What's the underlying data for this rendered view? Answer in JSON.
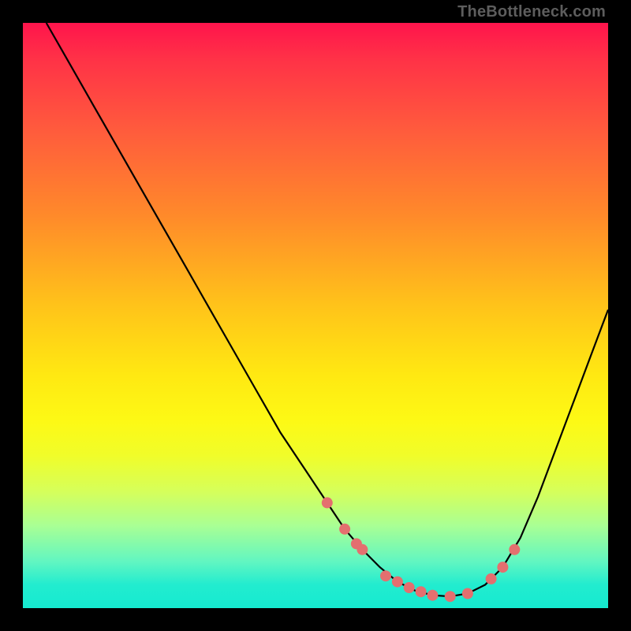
{
  "watermark": "TheBottleneck.com",
  "colors": {
    "frame_border": "#000000",
    "curve_stroke": "#000000",
    "dot_fill": "#e46f6f",
    "gradient_top": "#ff144c",
    "gradient_bottom": "#15ead0"
  },
  "chart_data": {
    "type": "line",
    "title": "",
    "xlabel": "",
    "ylabel": "",
    "xlim": [
      0,
      100
    ],
    "ylim": [
      0,
      100
    ],
    "x": [
      4,
      8,
      12,
      16,
      20,
      24,
      28,
      32,
      36,
      40,
      44,
      48,
      52,
      55,
      58,
      61,
      64,
      67,
      70,
      73,
      76,
      79,
      82,
      85,
      88,
      91,
      94,
      97,
      100
    ],
    "values": [
      100,
      93,
      86,
      79,
      72,
      65,
      58,
      51,
      44,
      37,
      30,
      24,
      18,
      13.5,
      10,
      7,
      4.5,
      3,
      2.2,
      2,
      2.5,
      4,
      7,
      12,
      19,
      27,
      35,
      43,
      51
    ],
    "highlight_points": [
      {
        "x": 52,
        "y": 18
      },
      {
        "x": 55,
        "y": 13.5
      },
      {
        "x": 57,
        "y": 11
      },
      {
        "x": 58,
        "y": 10
      },
      {
        "x": 62,
        "y": 5.5
      },
      {
        "x": 64,
        "y": 4.5
      },
      {
        "x": 66,
        "y": 3.5
      },
      {
        "x": 68,
        "y": 2.8
      },
      {
        "x": 70,
        "y": 2.2
      },
      {
        "x": 73,
        "y": 2
      },
      {
        "x": 76,
        "y": 2.5
      },
      {
        "x": 80,
        "y": 5
      },
      {
        "x": 82,
        "y": 7
      },
      {
        "x": 84,
        "y": 10
      }
    ],
    "note": "Values estimated from bottleneck-curve pixel positions; y is estimated bottleneck percentage (0% at curve bottom, 100% at top). Highlight points are the salmon dots clustered near the valley."
  }
}
